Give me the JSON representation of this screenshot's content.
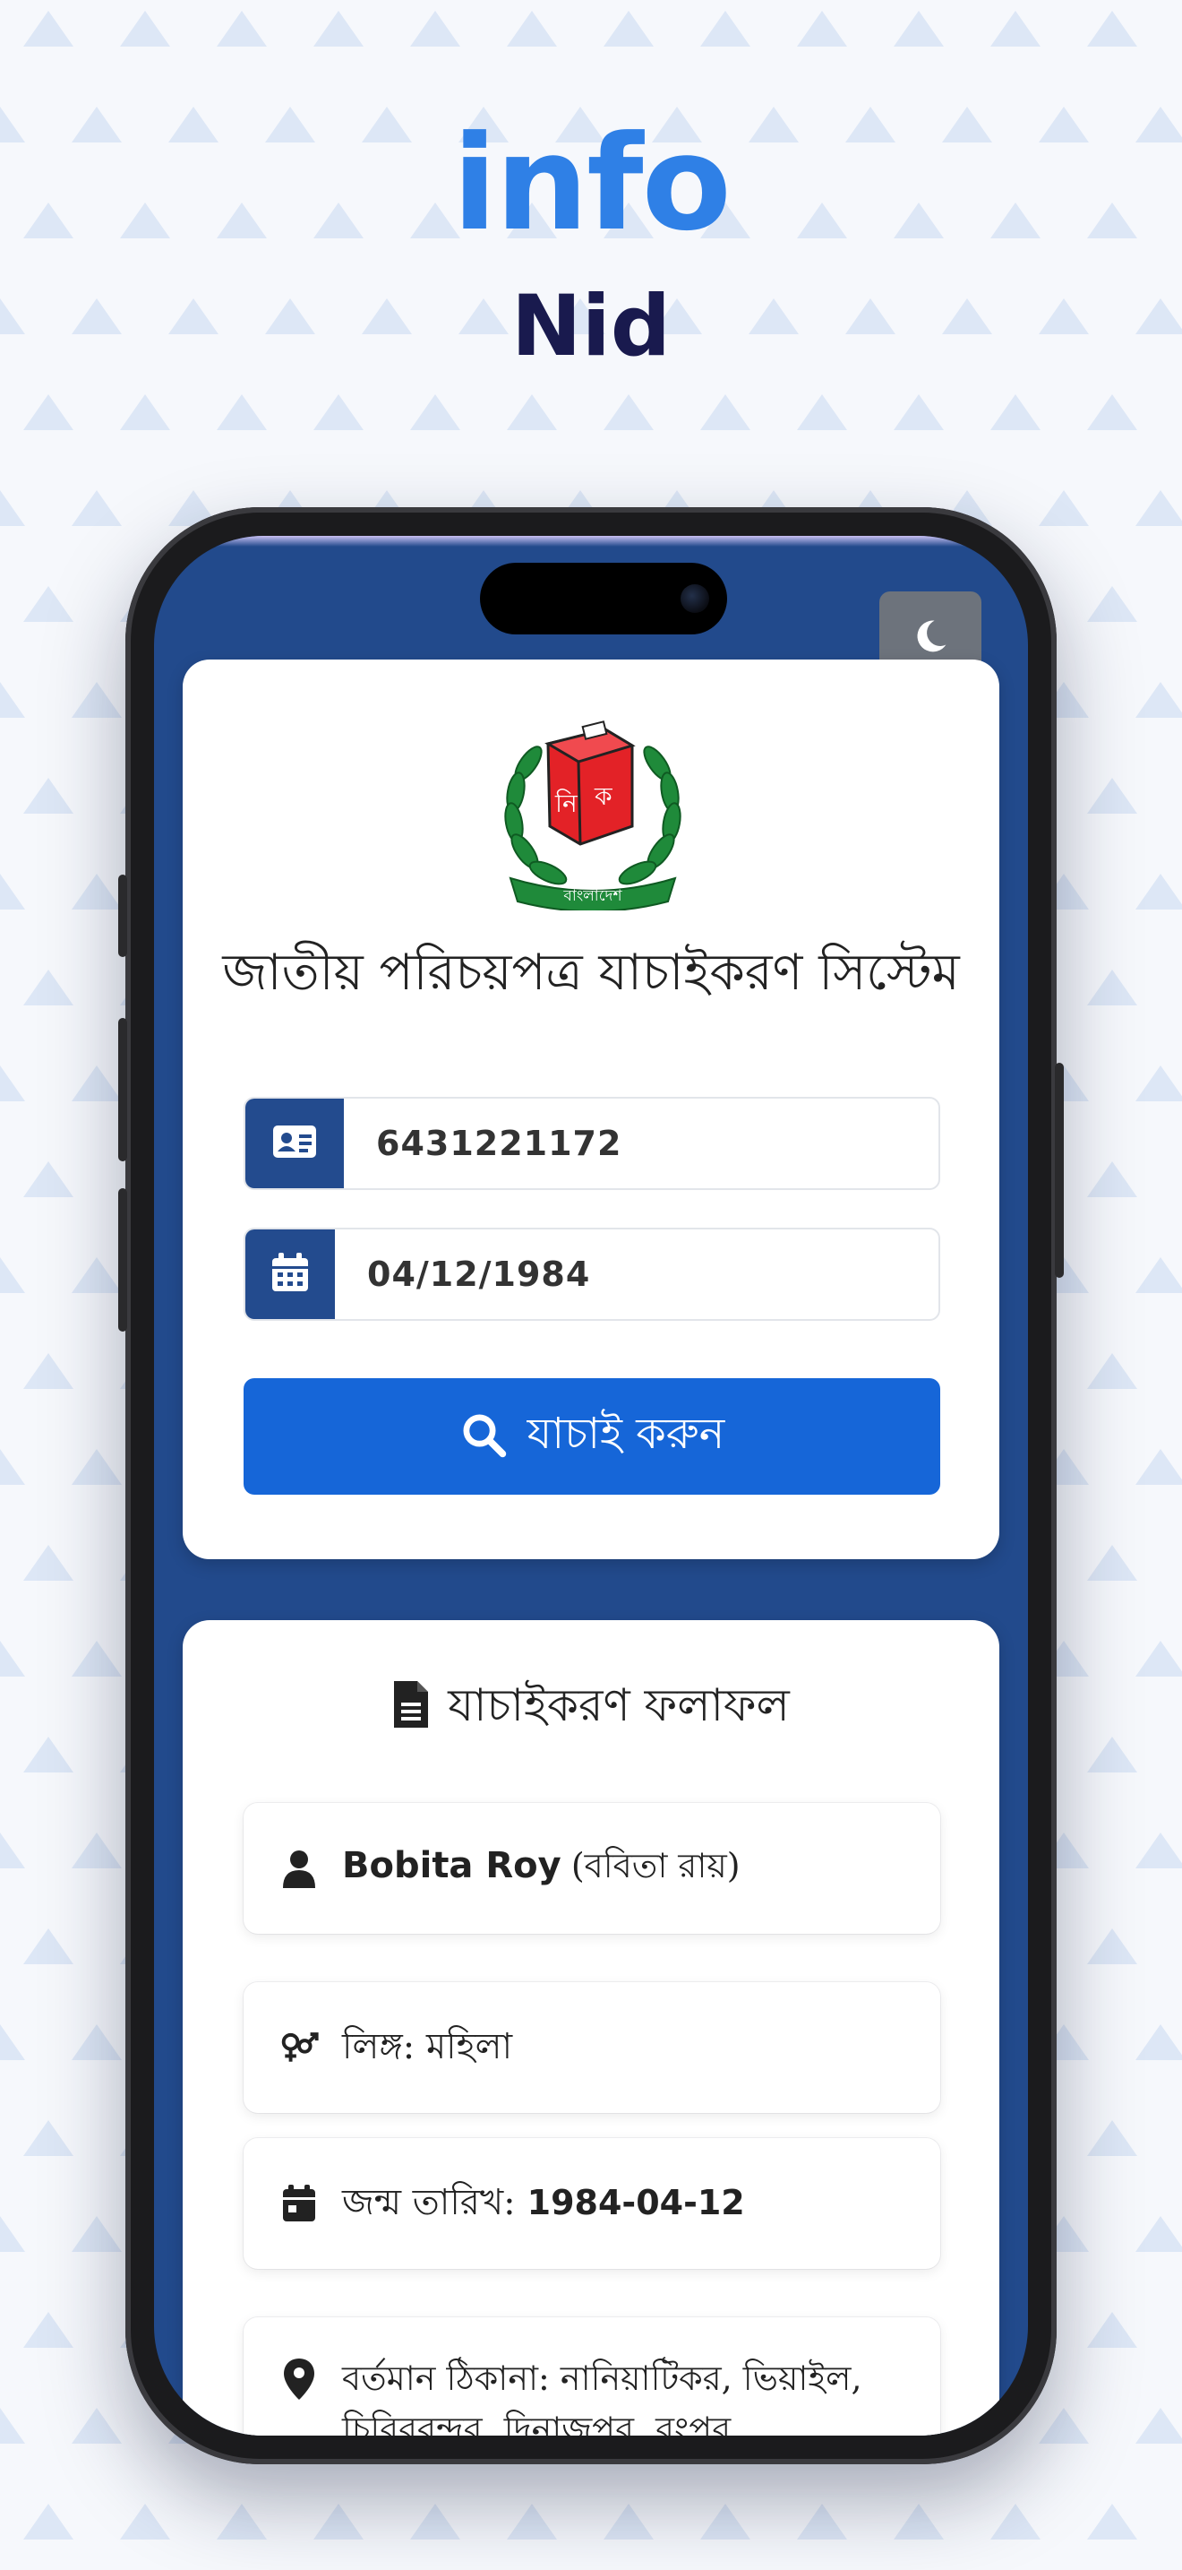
{
  "header": {
    "title": "info",
    "subtitle": "Nid"
  },
  "colors": {
    "title_blue": "#2f80e6",
    "subtitle_navy": "#191a4e",
    "screen_bg": "#224a8c",
    "primary_button": "#1666d8",
    "toggle_bg": "#6d737c"
  },
  "app": {
    "theme_toggle_icon": "moon-icon",
    "emblem": {
      "text_left": "নি",
      "text_right": "ক",
      "ribbon_text": "বাংলাদেশ"
    },
    "form": {
      "title": "জাতীয় পরিচয়পত্র যাচাইকরণ সিস্টেম",
      "nid_icon": "id-card-icon",
      "nid_value": "6431221172",
      "dob_icon": "calendar-icon",
      "dob_value": "04/12/1984",
      "submit_icon": "search-icon",
      "submit_label": "যাচাই করুন"
    },
    "result": {
      "title_icon": "document-icon",
      "title": "যাচাইকরণ ফলাফল",
      "name_en": "Bobita Roy",
      "name_bn": "(ববিতা রায়)",
      "gender_text": "লিঙ্গ: মহিলা",
      "dob_label": "জন্ম তারিখ:",
      "dob_value": "1984-04-12",
      "address_text": "বর্তমান ঠিকানা: নানিয়াটিকর, ভিয়াইল, চিরিরবন্দর, দিনাজপুর, রংপুর"
    }
  }
}
